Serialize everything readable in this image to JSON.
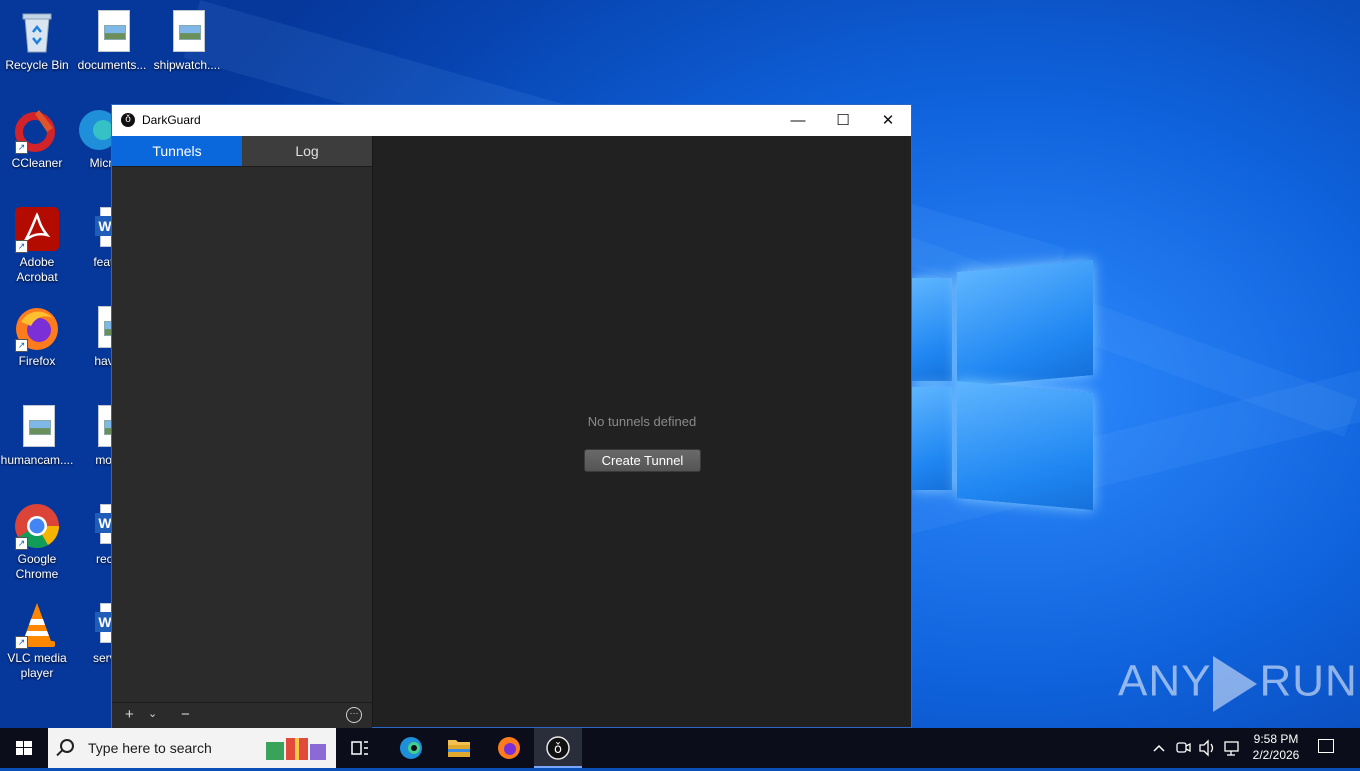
{
  "desktop": {
    "icons_col1": [
      {
        "label": "Recycle Bin"
      },
      {
        "label": "CCleaner"
      },
      {
        "label": "Adobe Acrobat"
      },
      {
        "label": "Firefox"
      },
      {
        "label": "humancam...."
      },
      {
        "label": "Google Chrome"
      },
      {
        "label": "VLC media player"
      }
    ],
    "icons_col2": [
      {
        "label": "documents..."
      },
      {
        "label": "Micr Ed"
      },
      {
        "label": "feature"
      },
      {
        "label": "having"
      },
      {
        "label": "month"
      },
      {
        "label": "receiv"
      },
      {
        "label": "service"
      }
    ],
    "icons_col3": [
      {
        "label": "shipwatch...."
      }
    ]
  },
  "window": {
    "title": "DarkGuard",
    "minimize_glyph": "—",
    "maximize_glyph": "☐",
    "close_glyph": "✕"
  },
  "sidebar": {
    "tabs": [
      {
        "label": "Tunnels",
        "active": true
      },
      {
        "label": "Log",
        "active": false
      }
    ],
    "footer": {
      "add_glyph": "+",
      "dropdown_glyph": "⌄",
      "remove_glyph": "−",
      "more_glyph": "···"
    }
  },
  "main": {
    "empty_message": "No tunnels defined",
    "create_button": "Create Tunnel"
  },
  "watermark": {
    "left": "ANY",
    "right": "RUN"
  },
  "taskbar": {
    "search_placeholder": "Type here to search",
    "clock_time": "9:58 PM",
    "clock_date": "2/2/2026"
  },
  "colors": {
    "accent_tab": "#0a67dc",
    "window_bg": "#1e1e1e",
    "taskbar_bg": "#0b0e1a"
  }
}
